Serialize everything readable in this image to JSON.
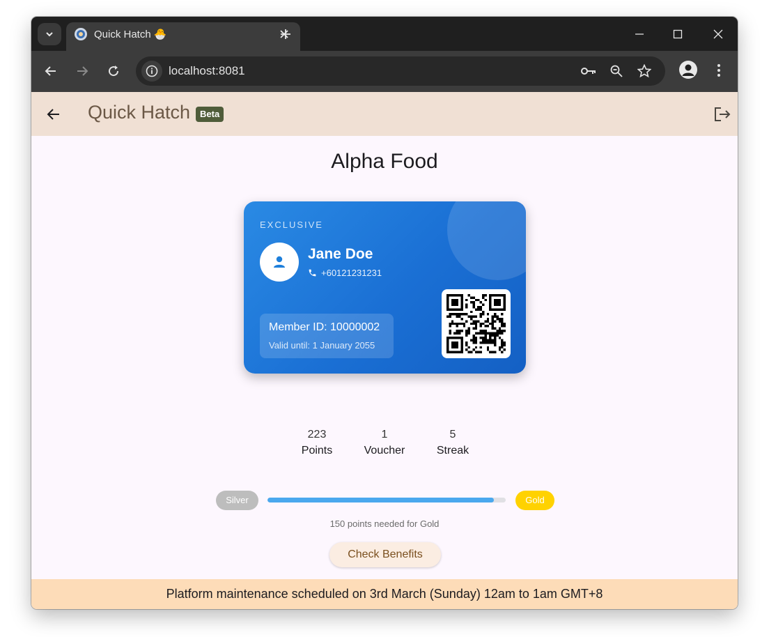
{
  "browser": {
    "tab_title": "Quick Hatch 🐣",
    "url": "localhost:8081"
  },
  "app": {
    "title": "Quick Hatch",
    "badge": "Beta"
  },
  "page": {
    "title": "Alpha Food"
  },
  "card": {
    "tier": "EXCLUSIVE",
    "name": "Jane Doe",
    "phone": "+60121231231",
    "member_id": "Member ID: 10000002",
    "valid_until": "Valid until: 1 January 2055"
  },
  "stats": [
    {
      "value": "223",
      "label": "Points"
    },
    {
      "value": "1",
      "label": "Voucher"
    },
    {
      "value": "5",
      "label": "Streak"
    }
  ],
  "progress": {
    "current_tier": "Silver",
    "next_tier": "Gold",
    "fraction": 0.95,
    "note": "150 points needed for Gold",
    "colors": {
      "silver": "#bdbdbd",
      "gold": "#ffd200",
      "fill": "#4aa8ee"
    }
  },
  "benefits_button": "Check Benefits",
  "banner": "Platform maintenance scheduled on 3rd March (Sunday) 12am to 1am GMT+8"
}
